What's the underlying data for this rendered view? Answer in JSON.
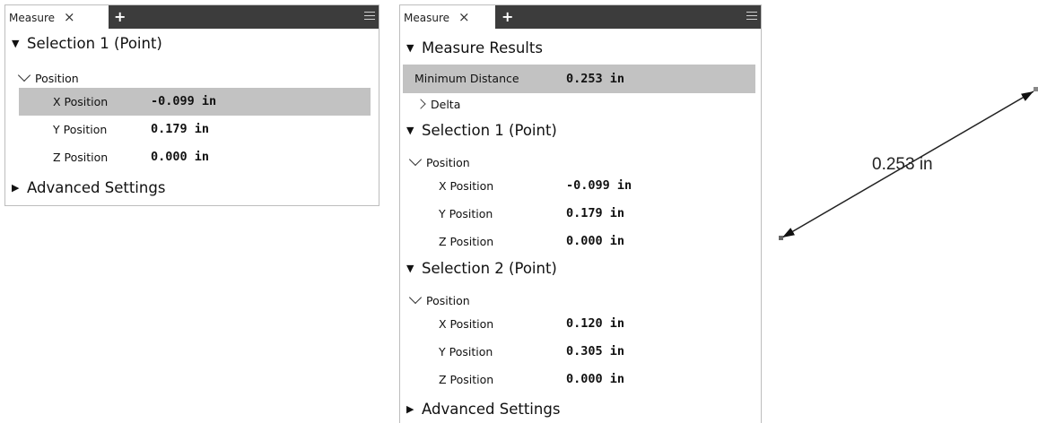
{
  "left_panel": {
    "tab_label": "Measure",
    "tab_close": "×",
    "tab_add": "+",
    "section_selection1": "Selection 1 (Point)",
    "position_header": "Position",
    "rows": [
      {
        "label": "X Position",
        "value": "-0.099 in",
        "selected": true
      },
      {
        "label": "Y Position",
        "value": "0.179 in",
        "selected": false
      },
      {
        "label": "Z Position",
        "value": "0.000 in",
        "selected": false
      }
    ],
    "section_advanced": "Advanced Settings"
  },
  "right_panel": {
    "tab_label": "Measure",
    "tab_close": "×",
    "tab_add": "+",
    "section_results": "Measure Results",
    "min_distance": {
      "label": "Minimum Distance",
      "value": "0.253 in"
    },
    "delta_label": "Delta",
    "section_selection1": "Selection 1 (Point)",
    "selection1_position_header": "Position",
    "selection1_rows": [
      {
        "label": "X Position",
        "value": "-0.099 in"
      },
      {
        "label": "Y Position",
        "value": "0.179 in"
      },
      {
        "label": "Z Position",
        "value": "0.000 in"
      }
    ],
    "section_selection2": "Selection 2 (Point)",
    "selection2_position_header": "Position",
    "selection2_rows": [
      {
        "label": "X Position",
        "value": "0.120 in"
      },
      {
        "label": "Y Position",
        "value": "0.305 in"
      },
      {
        "label": "Z Position",
        "value": "0.000 in"
      }
    ],
    "section_advanced": "Advanced Settings"
  },
  "viewport": {
    "dimension_label": "0.253 in"
  },
  "colors": {
    "tabbar": "#3c3c3c",
    "selected_row": "#c2c2c2",
    "border": "#bdbdbd"
  }
}
